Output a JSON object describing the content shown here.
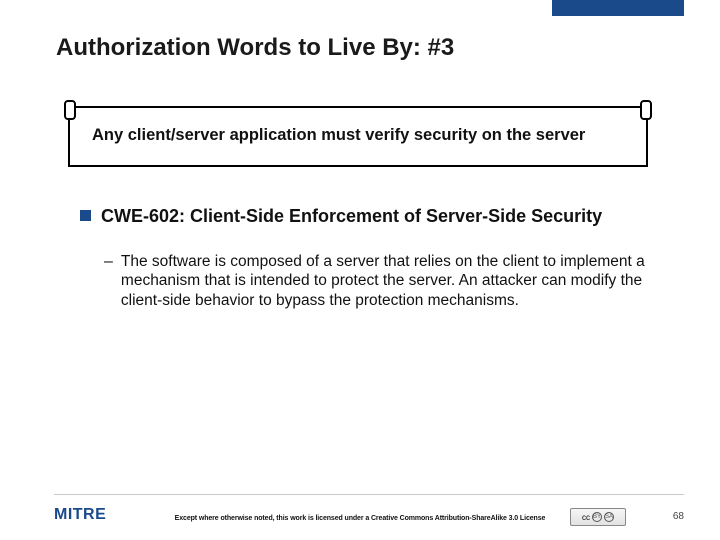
{
  "title": "Authorization Words to Live By: #3",
  "scroll_text": "Any client/server application must verify security on the server",
  "bullet_heading": "CWE-602: Client-Side Enforcement of Server-Side Security",
  "bullet_sub": "The software is composed of a server that relies on the client to implement a mechanism that is intended to protect the server.  An attacker can modify the client-side behavior to bypass the protection mechanisms.",
  "logo_text": "MITRE",
  "license_text": "Except where otherwise noted, this work is licensed under a Creative Commons Attribution-ShareAlike 3.0 License",
  "cc_label": "cc",
  "page_number": "68"
}
